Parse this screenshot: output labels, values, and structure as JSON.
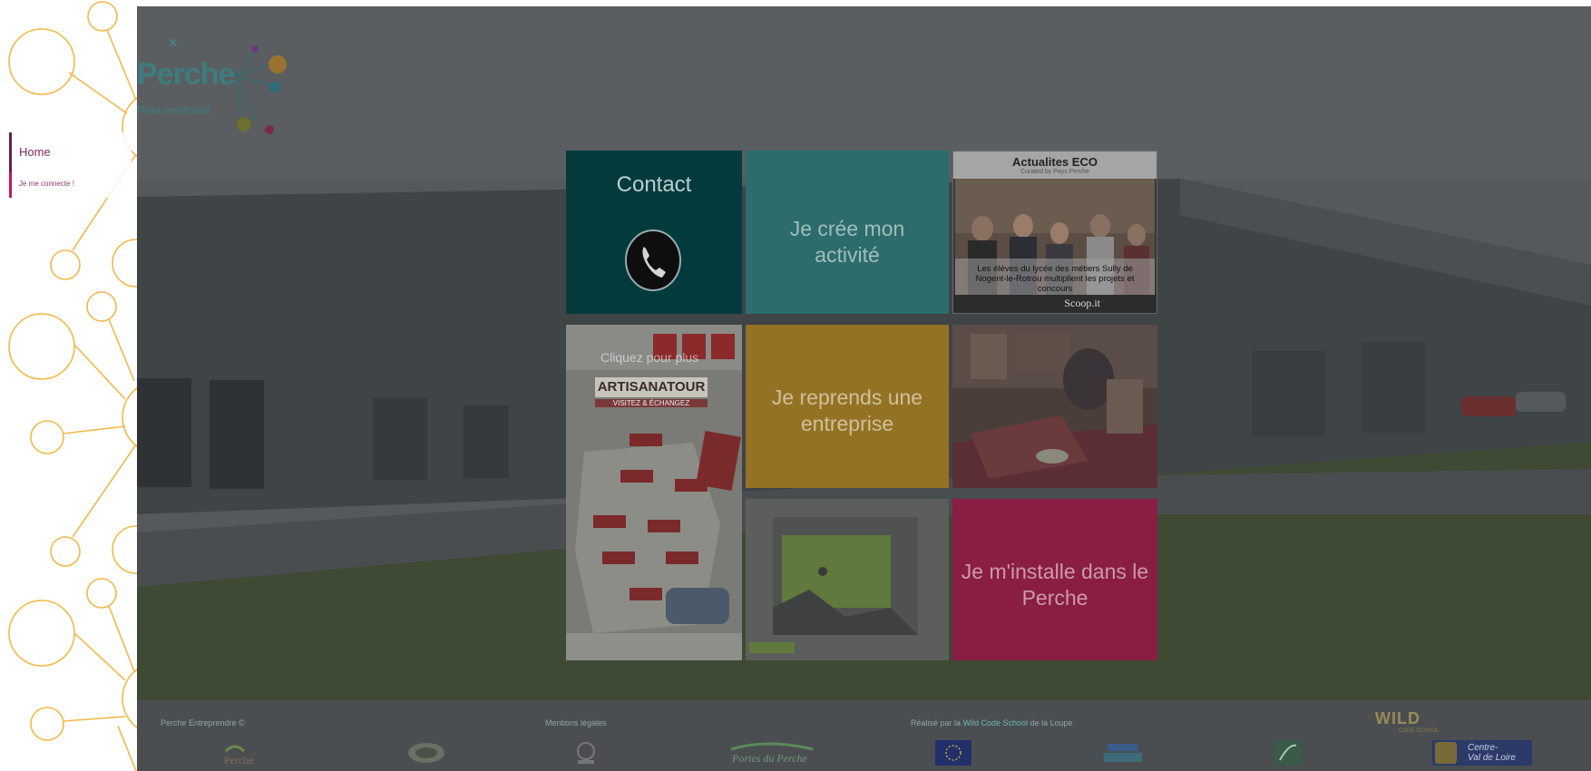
{
  "sidebar": {
    "items": [
      {
        "label": "Home"
      },
      {
        "label": "Je me connecte !"
      }
    ]
  },
  "logo": {
    "name": "Perche",
    "subtitle": "Pôle territorial",
    "close_glyph": "✕"
  },
  "tiles": {
    "contact": {
      "label": "Contact",
      "icon": "phone-icon"
    },
    "cree": {
      "label_line1": "Je crée mon",
      "label_line2": "activité"
    },
    "actualites": {
      "title": "Actualites ECO",
      "subtitle": "Curated by Pays Perche",
      "caption": "Les élèves du lycée des métiers Sully de Nogent-le-Rotrou multiplient les projets et concours",
      "brand": "Scoop.it"
    },
    "artisanatour": {
      "click_text": "Cliquez pour plus",
      "title": "ARTISANATOUR",
      "subtitle": "VISITEZ & ÉCHANGEZ"
    },
    "reprends": {
      "label_line1": "Je reprends une",
      "label_line2": "entreprise"
    },
    "installe": {
      "label_line1": "Je m'installe dans le",
      "label_line2": "Perche"
    }
  },
  "footer": {
    "copyright": "Perche Entreprendre ©",
    "legal": "Mentions légales",
    "credit_prefix": "Réalisé par la ",
    "credit_link": "Wild Code School",
    "credit_suffix": " de la Loupe",
    "wild_logo": "WILD",
    "wild_sub": "CODE SCHOOL",
    "region_logo": "Centre-Val de Loire",
    "region_logo_line1": "Centre-",
    "region_logo_line2": "Val de Loire",
    "logos": [
      "Perche",
      "Communauté",
      "Partenaire",
      "Portes du Perche",
      "Europe",
      "L'Europe s'engage",
      "Leader",
      "Centre-Val de Loire"
    ]
  },
  "colors": {
    "accent_yellow": "#f2b84b",
    "nav_purple": "#6b1c4c",
    "nav_pink": "#c2185b",
    "teal": "#2d6c6c",
    "overlay": "rgba(40,44,48,0.7)"
  }
}
